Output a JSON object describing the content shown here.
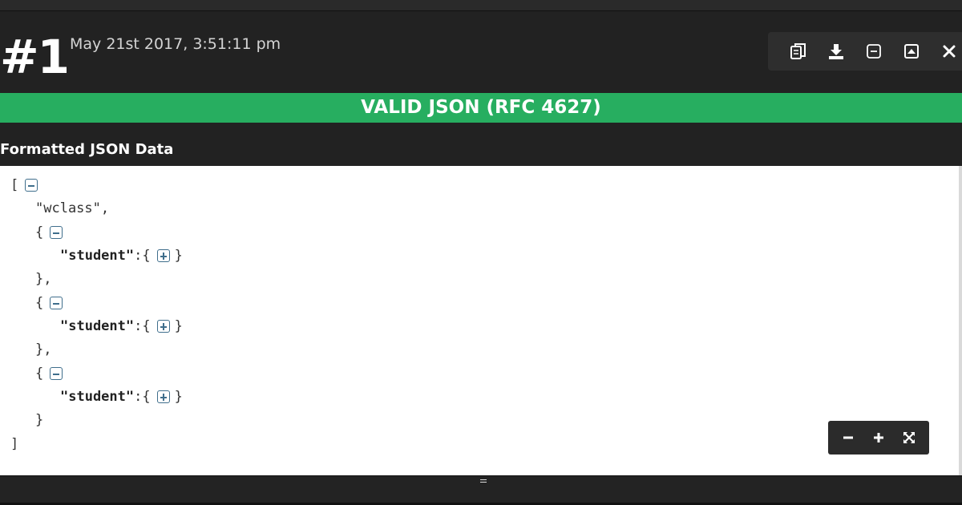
{
  "entry": {
    "number": "#1",
    "timestamp": "May 21st 2017, 3:51:11 pm"
  },
  "toolbar": {
    "icons": [
      "copy-icon",
      "download-icon",
      "collapse-icon",
      "expand-icon",
      "close-icon"
    ]
  },
  "validation": {
    "status_text": "VALID JSON (RFC 4627)",
    "color": "#27ae60"
  },
  "section": {
    "title": "Formatted JSON Data"
  },
  "json_view": {
    "lines": [
      {
        "text": "[",
        "toggle": "minus"
      },
      {
        "text": "\"wclass\","
      },
      {
        "text": "{",
        "toggle": "minus"
      },
      {
        "key": "\"student\"",
        "after": ":{",
        "toggle": "plus",
        "close": "}"
      },
      {
        "text": "},"
      },
      {
        "text": "{",
        "toggle": "minus"
      },
      {
        "key": "\"student\"",
        "after": ":{",
        "toggle": "plus",
        "close": "}"
      },
      {
        "text": "},"
      },
      {
        "text": "{",
        "toggle": "minus"
      },
      {
        "key": "\"student\"",
        "after": ":{",
        "toggle": "plus",
        "close": "}"
      },
      {
        "text": "}"
      },
      {
        "text": "]"
      }
    ]
  },
  "zoom": {
    "icons": [
      "zoom-out-icon",
      "zoom-in-icon",
      "fullscreen-icon"
    ]
  },
  "colors": {
    "background": "#222222",
    "panel": "#ffffff",
    "toggle": "#3f6e8c"
  }
}
